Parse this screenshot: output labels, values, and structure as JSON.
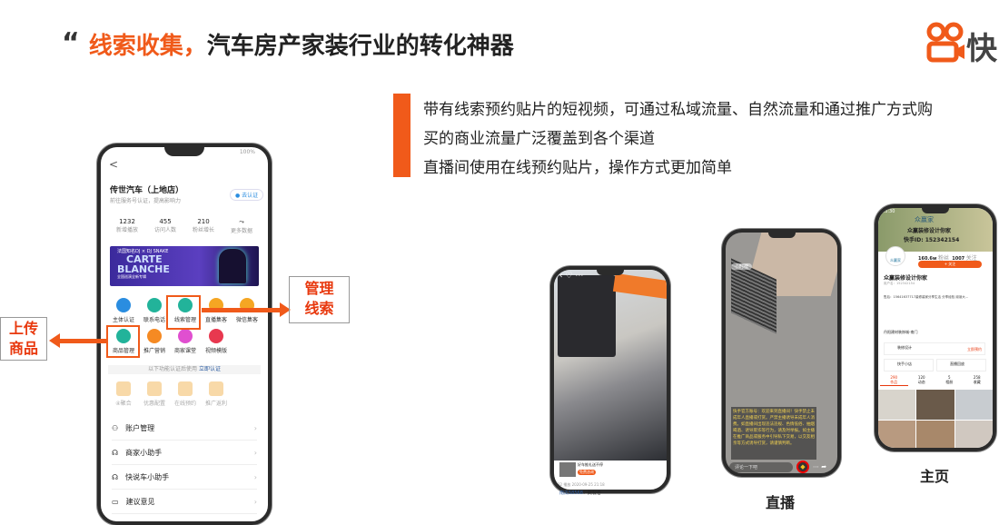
{
  "header": {
    "quote_mark": "“",
    "title_highlight": "线索收集，",
    "title_rest": "汽车房产家装行业的转化神器",
    "logo_text": "快"
  },
  "description": {
    "lines": [
      "带有线索预约贴片的短视频，可通过私域流量、自然流量和通过推广方式购",
      "买的商业流量广泛覆盖到各个渠道",
      "直播间使用在线预约贴片，操作方式更加简单"
    ]
  },
  "callouts": {
    "manage_leads": [
      "管理",
      "线索"
    ],
    "upload_goods": [
      "上传",
      "商品"
    ]
  },
  "colors": {
    "accent": "#f05a1a",
    "callout_red": "#e8380d"
  },
  "left_phone": {
    "status_right": "100%",
    "back": "<",
    "shop_name": "传世汽车（上地店）",
    "shop_sub": "前往服务号认证，提高影响力",
    "verify_btn": "去认证",
    "stats": [
      {
        "value": "1232",
        "label": "新增播放"
      },
      {
        "value": "455",
        "label": "访问人数"
      },
      {
        "value": "210",
        "label": "粉丝增长"
      },
      {
        "value": "⤳",
        "label": "更多数据"
      }
    ],
    "banner": {
      "top": "法国知名DJ × DJ SNAKE",
      "line1": "CARTE",
      "line2": "BLANCHE",
      "bottom": "全国巡演全新专辑"
    },
    "tools_row1": [
      {
        "label": "主体认证",
        "color": "#2a8de0"
      },
      {
        "label": "联系电话",
        "color": "#22b39a"
      },
      {
        "label": "线索管理",
        "color": "#22b39a"
      },
      {
        "label": "直播集客",
        "color": "#f5a623"
      },
      {
        "label": "微信集客",
        "color": "#f5a623"
      }
    ],
    "tools_row2": [
      {
        "label": "商品管理",
        "color": "#22b39a"
      },
      {
        "label": "推广营销",
        "color": "#f58a23"
      },
      {
        "label": "商家课堂",
        "color": "#e04fd0"
      },
      {
        "label": "视频模版",
        "color": "#e8384f"
      }
    ],
    "locked_notice": "以下功能认证后使用",
    "locked_link": "立即认证",
    "locked_tools": [
      "④聚合",
      "优惠配置",
      "在线预约",
      "推广返利"
    ],
    "menu": [
      {
        "icon": "user-icon",
        "glyph": "⚇",
        "label": "账户管理"
      },
      {
        "icon": "headset-icon",
        "glyph": "☊",
        "label": "商家小助手"
      },
      {
        "icon": "headset-icon",
        "glyph": "☊",
        "label": "快说车小助手"
      },
      {
        "icon": "feedback-icon",
        "glyph": "▭",
        "label": "建议意见"
      }
    ]
  },
  "video_phone": {
    "card_title": "好车推礼送不停",
    "card_btn": "免费咨询",
    "meta": "32 播放   2020-09-25 21:18",
    "caption_user": "南瓜58568",
    "caption_text": "：武裂卷"
  },
  "live_phone": {
    "label": "直播",
    "chip": "小时榜",
    "notice": "快手官方账号：欢迎来到直播间！快手禁止未成年人直播或打赏。严禁主播诱导未成年人消费。如直播间出现违法违规、色情低俗、抽烟喝酒、诱导欺诈等行为，请及时举报。如主播在推广商品或服务中引导私下交易，以交友相亲等方式诱导打赏，请谨慎判断。",
    "comment_placeholder": "评论一下吧"
  },
  "home_phone": {
    "label": "主页",
    "time": "23:30",
    "brand": "众赢家",
    "cover_title": "众赢装修设计你家",
    "cover_id": "快手ID: 152342154",
    "fans": "160.6w",
    "fans_label": "粉丝",
    "following": "1007",
    "following_label": "关注",
    "follow_btn": "+ 关注",
    "name": "众赢装修设计你家",
    "user_id": "用户名：152342154",
    "bio": "售后：15641637717装修装家分享生活 分享经验 阅读大…",
    "store": "丹阳建材装饰城-南门",
    "booking": "装修设计",
    "booking_btn": "立即预约",
    "shop": "快手小店",
    "replay": "直播回放",
    "tabs": [
      {
        "value": "290",
        "label": "作品"
      },
      {
        "value": "120",
        "label": "动态"
      },
      {
        "value": "5",
        "label": "相册"
      },
      {
        "value": "258",
        "label": "收藏"
      }
    ]
  }
}
